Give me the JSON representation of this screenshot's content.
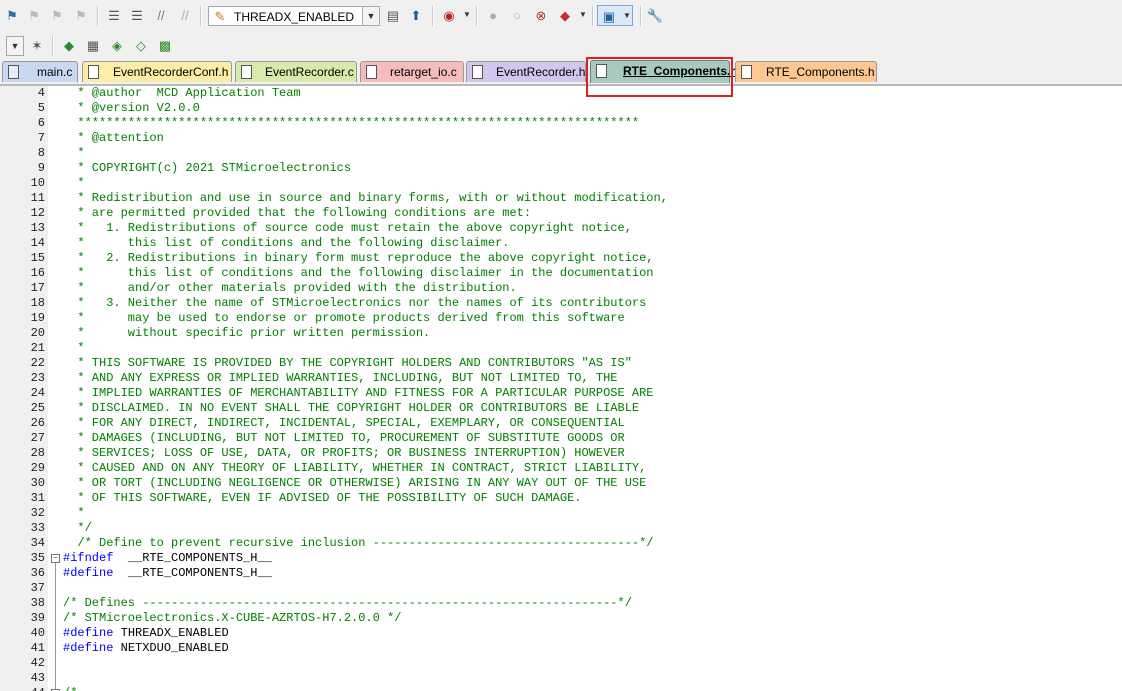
{
  "toolbar": {
    "target_combo_value": "THREADX_ENABLED"
  },
  "tabs": [
    {
      "label": "main.c",
      "bg": "#c9d8ef",
      "active": false
    },
    {
      "label": "EventRecorderConf.h",
      "bg": "#faeea6",
      "active": false
    },
    {
      "label": "EventRecorder.c",
      "bg": "#d7eaa9",
      "active": false
    },
    {
      "label": "retarget_io.c",
      "bg": "#f6bcbc",
      "active": false
    },
    {
      "label": "EventRecorder.h",
      "bg": "#d3c6ec",
      "active": false
    },
    {
      "label": "RTE_Components.h",
      "bg": "#ffffff",
      "active": true
    },
    {
      "label": "RTE_Components.h",
      "bg": "#fcc790",
      "active": false
    }
  ],
  "editor": {
    "lines": [
      {
        "n": "4",
        "segs": [
          {
            "t": "  * @author  MCD Application Team",
            "c": "cm"
          }
        ]
      },
      {
        "n": "5",
        "segs": [
          {
            "t": "  * @version V2.0.0",
            "c": "cm"
          }
        ]
      },
      {
        "n": "6",
        "segs": [
          {
            "t": "  ******************************************************************************",
            "c": "cm"
          }
        ]
      },
      {
        "n": "7",
        "segs": [
          {
            "t": "  * @attention",
            "c": "cm"
          }
        ]
      },
      {
        "n": "8",
        "segs": [
          {
            "t": "  *",
            "c": "cm"
          }
        ]
      },
      {
        "n": "9",
        "segs": [
          {
            "t": "  * COPYRIGHT(c) 2021 STMicroelectronics",
            "c": "cm"
          }
        ]
      },
      {
        "n": "10",
        "segs": [
          {
            "t": "  *",
            "c": "cm"
          }
        ]
      },
      {
        "n": "11",
        "segs": [
          {
            "t": "  * Redistribution and use in source and binary forms, with or without modification,",
            "c": "cm"
          }
        ]
      },
      {
        "n": "12",
        "segs": [
          {
            "t": "  * are permitted provided that the following conditions are met:",
            "c": "cm"
          }
        ]
      },
      {
        "n": "13",
        "segs": [
          {
            "t": "  *   1. Redistributions of source code must retain the above copyright notice,",
            "c": "cm"
          }
        ]
      },
      {
        "n": "14",
        "segs": [
          {
            "t": "  *      this list of conditions and the following disclaimer.",
            "c": "cm"
          }
        ]
      },
      {
        "n": "15",
        "segs": [
          {
            "t": "  *   2. Redistributions in binary form must reproduce the above copyright notice,",
            "c": "cm"
          }
        ]
      },
      {
        "n": "16",
        "segs": [
          {
            "t": "  *      this list of conditions and the following disclaimer in the documentation",
            "c": "cm"
          }
        ]
      },
      {
        "n": "17",
        "segs": [
          {
            "t": "  *      and/or other materials provided with the distribution.",
            "c": "cm"
          }
        ]
      },
      {
        "n": "18",
        "segs": [
          {
            "t": "  *   3. Neither the name of STMicroelectronics nor the names of its contributors",
            "c": "cm"
          }
        ]
      },
      {
        "n": "19",
        "segs": [
          {
            "t": "  *      may be used to endorse or promote products derived from this software",
            "c": "cm"
          }
        ]
      },
      {
        "n": "20",
        "segs": [
          {
            "t": "  *      without specific prior written permission.",
            "c": "cm"
          }
        ]
      },
      {
        "n": "21",
        "segs": [
          {
            "t": "  *",
            "c": "cm"
          }
        ]
      },
      {
        "n": "22",
        "segs": [
          {
            "t": "  * THIS SOFTWARE IS PROVIDED BY THE COPYRIGHT HOLDERS AND CONTRIBUTORS \"AS IS\"",
            "c": "cm"
          }
        ]
      },
      {
        "n": "23",
        "segs": [
          {
            "t": "  * AND ANY EXPRESS OR IMPLIED WARRANTIES, INCLUDING, BUT NOT LIMITED TO, THE",
            "c": "cm"
          }
        ]
      },
      {
        "n": "24",
        "segs": [
          {
            "t": "  * IMPLIED WARRANTIES OF MERCHANTABILITY AND FITNESS FOR A PARTICULAR PURPOSE ARE",
            "c": "cm"
          }
        ]
      },
      {
        "n": "25",
        "segs": [
          {
            "t": "  * DISCLAIMED. IN NO EVENT SHALL THE COPYRIGHT HOLDER OR CONTRIBUTORS BE LIABLE",
            "c": "cm"
          }
        ]
      },
      {
        "n": "26",
        "segs": [
          {
            "t": "  * FOR ANY DIRECT, INDIRECT, INCIDENTAL, SPECIAL, EXEMPLARY, OR CONSEQUENTIAL",
            "c": "cm"
          }
        ]
      },
      {
        "n": "27",
        "segs": [
          {
            "t": "  * DAMAGES (INCLUDING, BUT NOT LIMITED TO, PROCUREMENT OF SUBSTITUTE GOODS OR",
            "c": "cm"
          }
        ]
      },
      {
        "n": "28",
        "segs": [
          {
            "t": "  * SERVICES; LOSS OF USE, DATA, OR PROFITS; OR BUSINESS INTERRUPTION) HOWEVER",
            "c": "cm"
          }
        ]
      },
      {
        "n": "29",
        "segs": [
          {
            "t": "  * CAUSED AND ON ANY THEORY OF LIABILITY, WHETHER IN CONTRACT, STRICT LIABILITY,",
            "c": "cm"
          }
        ]
      },
      {
        "n": "30",
        "segs": [
          {
            "t": "  * OR TORT (INCLUDING NEGLIGENCE OR OTHERWISE) ARISING IN ANY WAY OUT OF THE USE",
            "c": "cm"
          }
        ]
      },
      {
        "n": "31",
        "segs": [
          {
            "t": "  * OF THIS SOFTWARE, EVEN IF ADVISED OF THE POSSIBILITY OF SUCH DAMAGE.",
            "c": "cm"
          }
        ]
      },
      {
        "n": "32",
        "segs": [
          {
            "t": "  *",
            "c": "cm"
          }
        ]
      },
      {
        "n": "33",
        "segs": [
          {
            "t": "  */",
            "c": "cm"
          }
        ]
      },
      {
        "n": "34",
        "segs": [
          {
            "t": "  /* Define to prevent recursive inclusion -------------------------------------*/",
            "c": "cm"
          }
        ]
      },
      {
        "n": "35",
        "segs": [
          {
            "t": "#ifndef",
            "c": "pp"
          },
          {
            "t": "  __RTE_COMPONENTS_H__",
            "c": "id"
          }
        ]
      },
      {
        "n": "36",
        "segs": [
          {
            "t": "#define",
            "c": "pp"
          },
          {
            "t": "  __RTE_COMPONENTS_H__",
            "c": "id"
          }
        ]
      },
      {
        "n": "37",
        "segs": []
      },
      {
        "n": "38",
        "segs": [
          {
            "t": "/* Defines ------------------------------------------------------------------*/",
            "c": "cm"
          }
        ]
      },
      {
        "n": "39",
        "segs": [
          {
            "t": "/* STMicroelectronics.X-CUBE-AZRTOS-H7.2.0.0 */",
            "c": "cm"
          }
        ]
      },
      {
        "n": "40",
        "segs": [
          {
            "t": "#define",
            "c": "pp"
          },
          {
            "t": " THREADX_ENABLED",
            "c": "id"
          }
        ]
      },
      {
        "n": "41",
        "segs": [
          {
            "t": "#define",
            "c": "pp"
          },
          {
            "t": " NETXDUO_ENABLED",
            "c": "id"
          }
        ]
      },
      {
        "n": "42",
        "segs": []
      },
      {
        "n": "43",
        "segs": []
      },
      {
        "n": "44",
        "segs": [
          {
            "t": "/*",
            "c": "cm"
          }
        ]
      }
    ]
  },
  "colors": {
    "comment": "#008000",
    "preprocessor": "#0000ff",
    "highlight_box": "#e02020"
  }
}
